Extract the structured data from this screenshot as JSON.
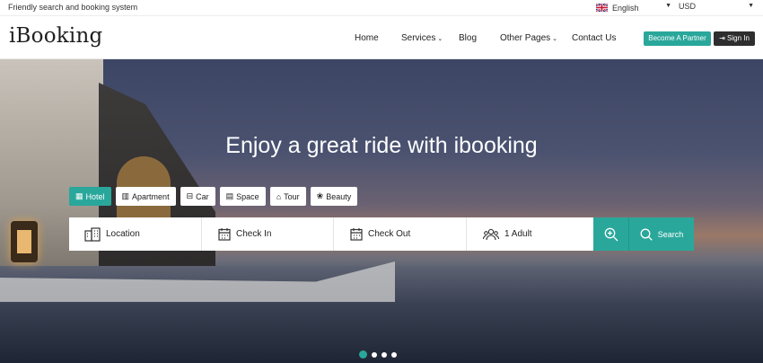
{
  "topbar": {
    "tagline": "Friendly search and booking system",
    "language": "English",
    "currency": "USD"
  },
  "header": {
    "logo": "iBooking",
    "nav": [
      "Home",
      "Services",
      "Blog",
      "Other Pages",
      "Contact Us"
    ],
    "partner_button": "Become A Partner",
    "signin_button": "Sign In"
  },
  "hero": {
    "headline": "Enjoy a great ride with ibooking",
    "tabs": [
      "Hotel",
      "Apartment",
      "Car",
      "Space",
      "Tour",
      "Beauty"
    ],
    "active_tab": "Hotel",
    "search": {
      "location": "Location",
      "check_in": "Check In",
      "check_out": "Check Out",
      "guests": "1 Adult",
      "button": "Search"
    },
    "slides": 4,
    "active_slide": 1
  },
  "colors": {
    "accent": "#2aa79b",
    "dark_button": "#2e2e2e"
  }
}
